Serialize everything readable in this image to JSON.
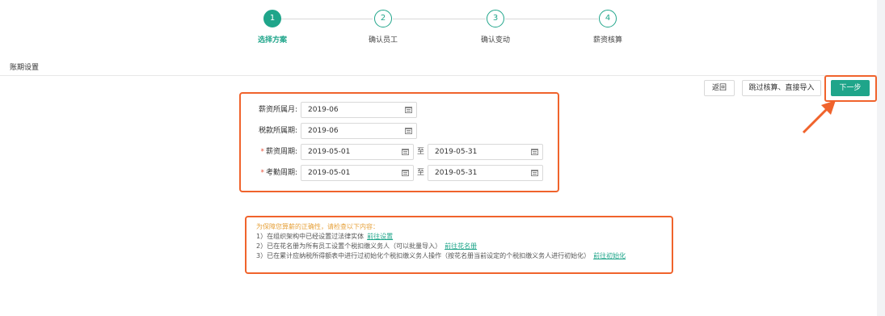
{
  "steps": [
    {
      "num": "1",
      "label": "选择方案",
      "active": true
    },
    {
      "num": "2",
      "label": "确认员工",
      "active": false
    },
    {
      "num": "3",
      "label": "确认变动",
      "active": false
    },
    {
      "num": "4",
      "label": "薪资核算",
      "active": false
    }
  ],
  "section_title": "账期设置",
  "toolbar": {
    "back_label": "返回",
    "skip_label": "跳过核算、直接导入",
    "next_label": "下一步"
  },
  "form": {
    "salary_month": {
      "label": "薪资所属月:",
      "value": "2019-06"
    },
    "tax_period": {
      "label": "税款所属期:",
      "value": "2019-06"
    },
    "salary_cycle": {
      "label": "薪资周期:",
      "required_mark": "*",
      "start": "2019-05-01",
      "to": "至",
      "end": "2019-05-31"
    },
    "attendance_cycle": {
      "label": "考勤周期:",
      "required_mark": "*",
      "start": "2019-05-01",
      "to": "至",
      "end": "2019-05-31"
    }
  },
  "notice": {
    "title": "为保障您算薪的正确性，请检查以下内容：",
    "items": [
      {
        "text": "1）在组织架构中已经设置过法律实体",
        "link": "前往设置"
      },
      {
        "text": "2）已在花名册为所有员工设置个税扣缴义务人（可以批量导入）",
        "link": "前往花名册"
      },
      {
        "text": "3）已在累计应纳税所得额表中进行过初始化个税扣缴义务人操作（按花名册当前设定的个税扣缴义务人进行初始化）",
        "link": "前往初始化"
      }
    ]
  },
  "colors": {
    "accent": "#1fa58a",
    "highlight": "#f0632c",
    "notice_title": "#e6a23c",
    "required": "#e5533c"
  }
}
